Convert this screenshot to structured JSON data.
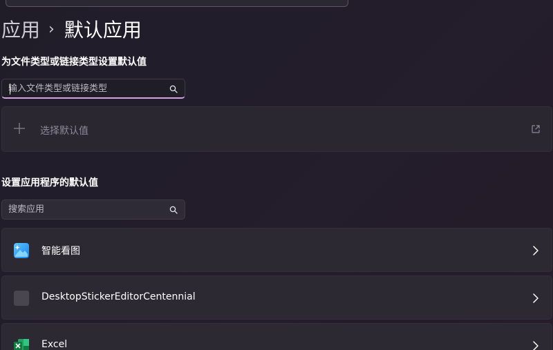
{
  "breadcrumb": {
    "parent": "应用",
    "separator": "›",
    "current": "默认应用"
  },
  "file_types_section": {
    "title": "为文件类型或链接类型设置默认值",
    "search_placeholder": "输入文件类型或链接类型",
    "choose_default_label": "选择默认值"
  },
  "apps_section": {
    "title": "设置应用程序的默认值",
    "search_placeholder": "搜索应用",
    "apps": [
      {
        "name": "智能看图",
        "icon": "image-viewer-app-icon"
      },
      {
        "name": "DesktopStickerEditorCentennial",
        "icon": "generic-app-icon"
      },
      {
        "name": "Excel",
        "icon": "excel-icon"
      }
    ]
  },
  "colors": {
    "background": "#221d2a",
    "card": "#2c2933",
    "focus_underline": "#d4a4e6"
  }
}
